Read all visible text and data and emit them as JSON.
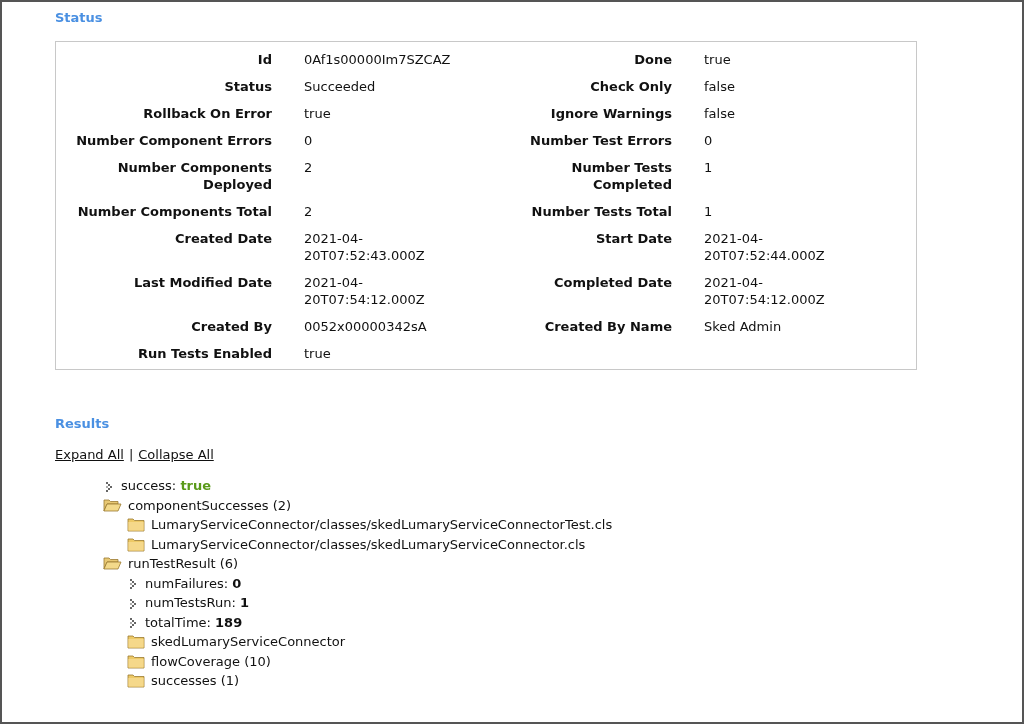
{
  "status": {
    "title": "Status",
    "rows": [
      {
        "left": {
          "label": "Id",
          "value": "0Af1s00000Im7SZCAZ"
        },
        "right": {
          "label": "Done",
          "value": "true"
        }
      },
      {
        "left": {
          "label": "Status",
          "value": "Succeeded"
        },
        "right": {
          "label": "Check Only",
          "value": "false"
        }
      },
      {
        "left": {
          "label": "Rollback On Error",
          "value": "true"
        },
        "right": {
          "label": "Ignore Warnings",
          "value": "false"
        }
      },
      {
        "left": {
          "label": "Number Component Errors",
          "value": "0"
        },
        "right": {
          "label": "Number Test Errors",
          "value": "0"
        }
      },
      {
        "left": {
          "label": "Number Components Deployed",
          "value": "2"
        },
        "right": {
          "label": "Number Tests Completed",
          "value": "1"
        }
      },
      {
        "left": {
          "label": "Number Components Total",
          "value": "2"
        },
        "right": {
          "label": "Number Tests Total",
          "value": "1"
        }
      },
      {
        "left": {
          "label": "Created Date",
          "value": "2021-04-20T07:52:43.000Z"
        },
        "right": {
          "label": "Start Date",
          "value": "2021-04-20T07:52:44.000Z"
        }
      },
      {
        "left": {
          "label": "Last Modified Date",
          "value": "2021-04-20T07:54:12.000Z"
        },
        "right": {
          "label": "Completed Date",
          "value": "2021-04-20T07:54:12.000Z"
        }
      },
      {
        "left": {
          "label": "Created By",
          "value": "0052x00000342sA"
        },
        "right": {
          "label": "Created By Name",
          "value": "Sked Admin"
        }
      },
      {
        "left": {
          "label": "Run Tests Enabled",
          "value": "true"
        }
      }
    ]
  },
  "results": {
    "title": "Results",
    "expand_all": "Expand All",
    "separator": "|",
    "collapse_all": "Collapse All",
    "tree": [
      {
        "kind": "boolean",
        "key": "success:",
        "value": "true"
      },
      {
        "kind": "folder",
        "label": "componentSuccesses (2)",
        "expanded": true,
        "children": [
          {
            "kind": "folder",
            "label": "LumaryServiceConnector/classes/skedLumaryServiceConnectorTest.cls",
            "expanded": false
          },
          {
            "kind": "folder",
            "label": "LumaryServiceConnector/classes/skedLumaryServiceConnector.cls",
            "expanded": false
          }
        ]
      },
      {
        "kind": "folder",
        "label": "runTestResult (6)",
        "expanded": true,
        "children": [
          {
            "kind": "number",
            "key": "numFailures:",
            "value": "0"
          },
          {
            "kind": "number",
            "key": "numTestsRun:",
            "value": "1"
          },
          {
            "kind": "number",
            "key": "totalTime:",
            "value": "189"
          },
          {
            "kind": "folder",
            "label": "skedLumaryServiceConnector",
            "expanded": false
          },
          {
            "kind": "folder",
            "label": "flowCoverage (10)",
            "expanded": false
          },
          {
            "kind": "folder",
            "label": "successes (1)",
            "expanded": false
          }
        ]
      }
    ]
  }
}
